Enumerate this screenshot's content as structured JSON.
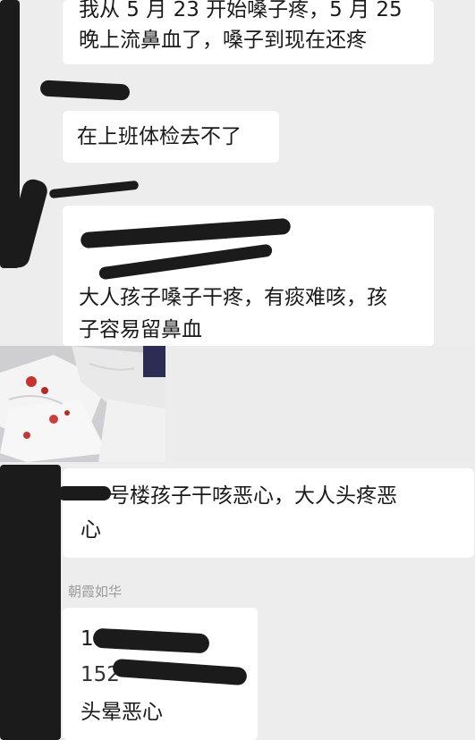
{
  "messages": [
    {
      "lines": [
        "我从 5 月 23 开始嗓子疼，5 月 25",
        "晚上流鼻血了，嗓子到现在还疼"
      ]
    },
    {
      "lines": [
        "在上班体检去不了"
      ]
    },
    {
      "lines": [
        "大人孩子嗓子干疼，有痰难咳，孩",
        "子容易留鼻血"
      ]
    },
    {
      "lines": [
        "号楼孩子干咳恶心，大人头疼恶",
        "心"
      ]
    },
    {
      "lines": [
        "16",
        "152",
        "头晕恶心"
      ]
    }
  ],
  "senders": {
    "s5": "朝霞如华"
  },
  "photo": {
    "icon": "tissues-with-blood-photo"
  }
}
